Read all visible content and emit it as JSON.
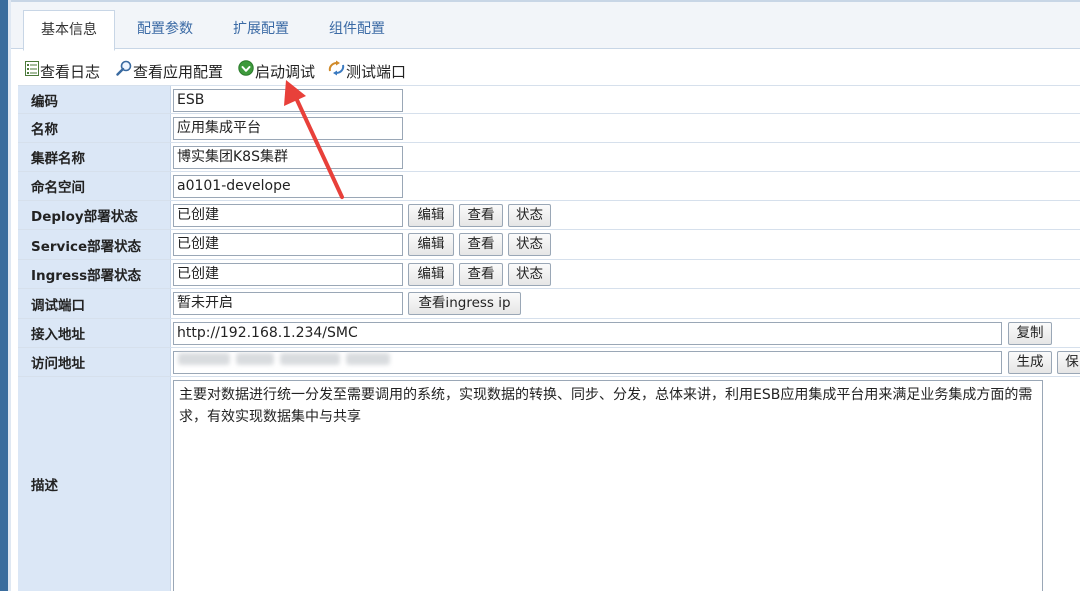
{
  "tabs": [
    "基本信息",
    "配置参数",
    "扩展配置",
    "组件配置"
  ],
  "toolbar": {
    "view_log": "查看日志",
    "view_app_config": "查看应用配置",
    "start_debug": "启动调试",
    "test_port": "测试端口"
  },
  "buttons": {
    "edit": "编辑",
    "view": "查看",
    "status": "状态",
    "view_ingress_ip": "查看ingress ip",
    "copy": "复制",
    "generate": "生成",
    "save_partial": "保"
  },
  "fields": {
    "code": {
      "label": "编码",
      "value": "ESB"
    },
    "name": {
      "label": "名称",
      "value": "应用集成平台"
    },
    "cluster": {
      "label": "集群名称",
      "value": "博实集团K8S集群"
    },
    "namespace": {
      "label": "命名空间",
      "value": "a0101-develope"
    },
    "deploy_status": {
      "label": "Deploy部署状态",
      "value": "已创建"
    },
    "service_status": {
      "label": "Service部署状态",
      "value": "已创建"
    },
    "ingress_status": {
      "label": "Ingress部署状态",
      "value": "已创建"
    },
    "debug_port": {
      "label": "调试端口",
      "value": "暂未开启"
    },
    "access_addr": {
      "label": "接入地址",
      "value": "http://192.168.1.234/SMC"
    },
    "visit_addr": {
      "label": "访问地址",
      "value": ""
    },
    "description": {
      "label": "描述",
      "value": "主要对数据进行统一分发至需要调用的系统，实现数据的转换、同步、分发，总体来讲，利用ESB应用集成平台用来满足业务集成方面的需求，有效实现数据集中与共享"
    }
  },
  "colors": {
    "label_bg": "#dbe7f6",
    "tab_text": "#3b6aa5",
    "arrow": "#e8403a"
  },
  "icons": {
    "view_log": "list-icon",
    "view_app_config": "magnifier-icon",
    "start_debug": "play-circle-icon",
    "test_port": "plug-icon"
  }
}
